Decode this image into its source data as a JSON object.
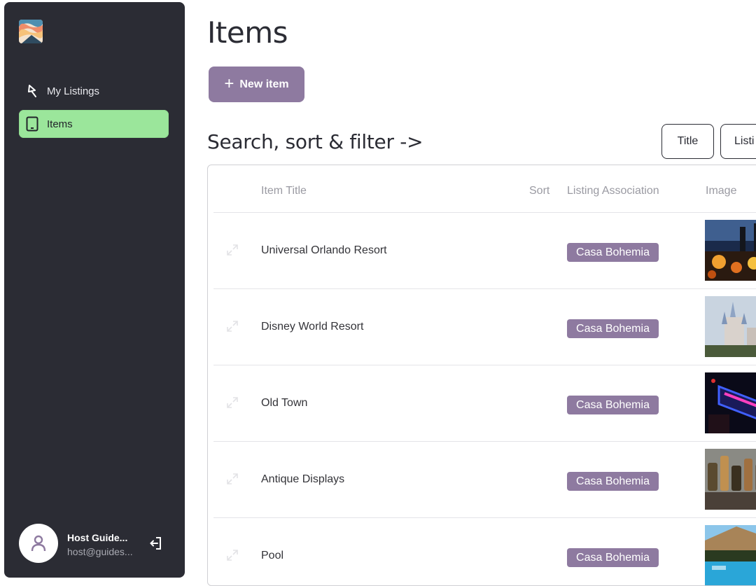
{
  "sidebar": {
    "items": [
      {
        "label": "My Listings",
        "icon": "bolt-icon"
      },
      {
        "label": "Items",
        "icon": "tablet-icon",
        "active": true
      }
    ],
    "active_color": "#9be69b",
    "user": {
      "name": "Host Guide...",
      "email": "host@guides..."
    }
  },
  "main": {
    "title": "Items",
    "new_button_label": "New item",
    "section_title": "Search, sort & filter ->",
    "filter_buttons": [
      "Title",
      "Listi"
    ],
    "table": {
      "columns": [
        "Item Title",
        "Sort",
        "Listing Association",
        "Image"
      ],
      "rows": [
        {
          "title": "Universal Orlando Resort",
          "listing": "Casa Bohemia",
          "image": "night-crowd-photo"
        },
        {
          "title": "Disney World Resort",
          "listing": "Casa Bohemia",
          "image": "castle-photo"
        },
        {
          "title": "Old Town",
          "listing": "Casa Bohemia",
          "image": "neon-sign-photo"
        },
        {
          "title": "Antique Displays",
          "listing": "Casa Bohemia",
          "image": "bottles-photo"
        },
        {
          "title": "Pool",
          "listing": "Casa Bohemia",
          "image": "pool-photo"
        }
      ]
    }
  },
  "colors": {
    "sidebar_bg": "#2b2c34",
    "accent": "#8e7aa0",
    "active": "#9be69b"
  }
}
